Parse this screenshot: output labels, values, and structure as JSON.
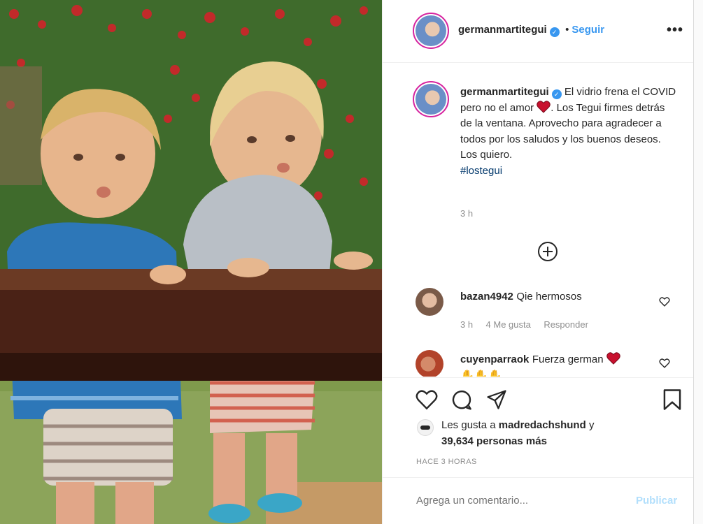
{
  "post": {
    "username": "germanmartitegui",
    "follow_label": "Seguir",
    "more_icon": "more-options-icon",
    "caption": {
      "part1": "El vidrio frena el COVID pero no el amor",
      "part2": ". Los Tegui firmes detrás de la ventana. Aprovecho para agradecer a todos por los saludos y los buenos deseos. Los quiero.",
      "hashtag": "#lostegui",
      "time": "3 h"
    },
    "load_more_icon": "plus-circle-icon"
  },
  "comments": [
    {
      "user": "bazan4942",
      "text": "Qie hermosos",
      "time": "3 h",
      "likes": "4 Me gusta",
      "reply": "Responder"
    },
    {
      "user": "cuyenparraok",
      "text": "Fuerza german"
    }
  ],
  "actions": {
    "likes_prefix": "Les gusta a",
    "likes_user": "madredachshund",
    "likes_mid": "y",
    "likes_count": "39,634 personas más",
    "timestamp": "HACE 3 HORAS"
  },
  "comment_box": {
    "placeholder": "Agrega un comentario...",
    "publish_label": "Publicar"
  },
  "colors": {
    "accent": "#3897f0",
    "heart": "#ed4956",
    "publish_disabled": "#b2dffc"
  }
}
